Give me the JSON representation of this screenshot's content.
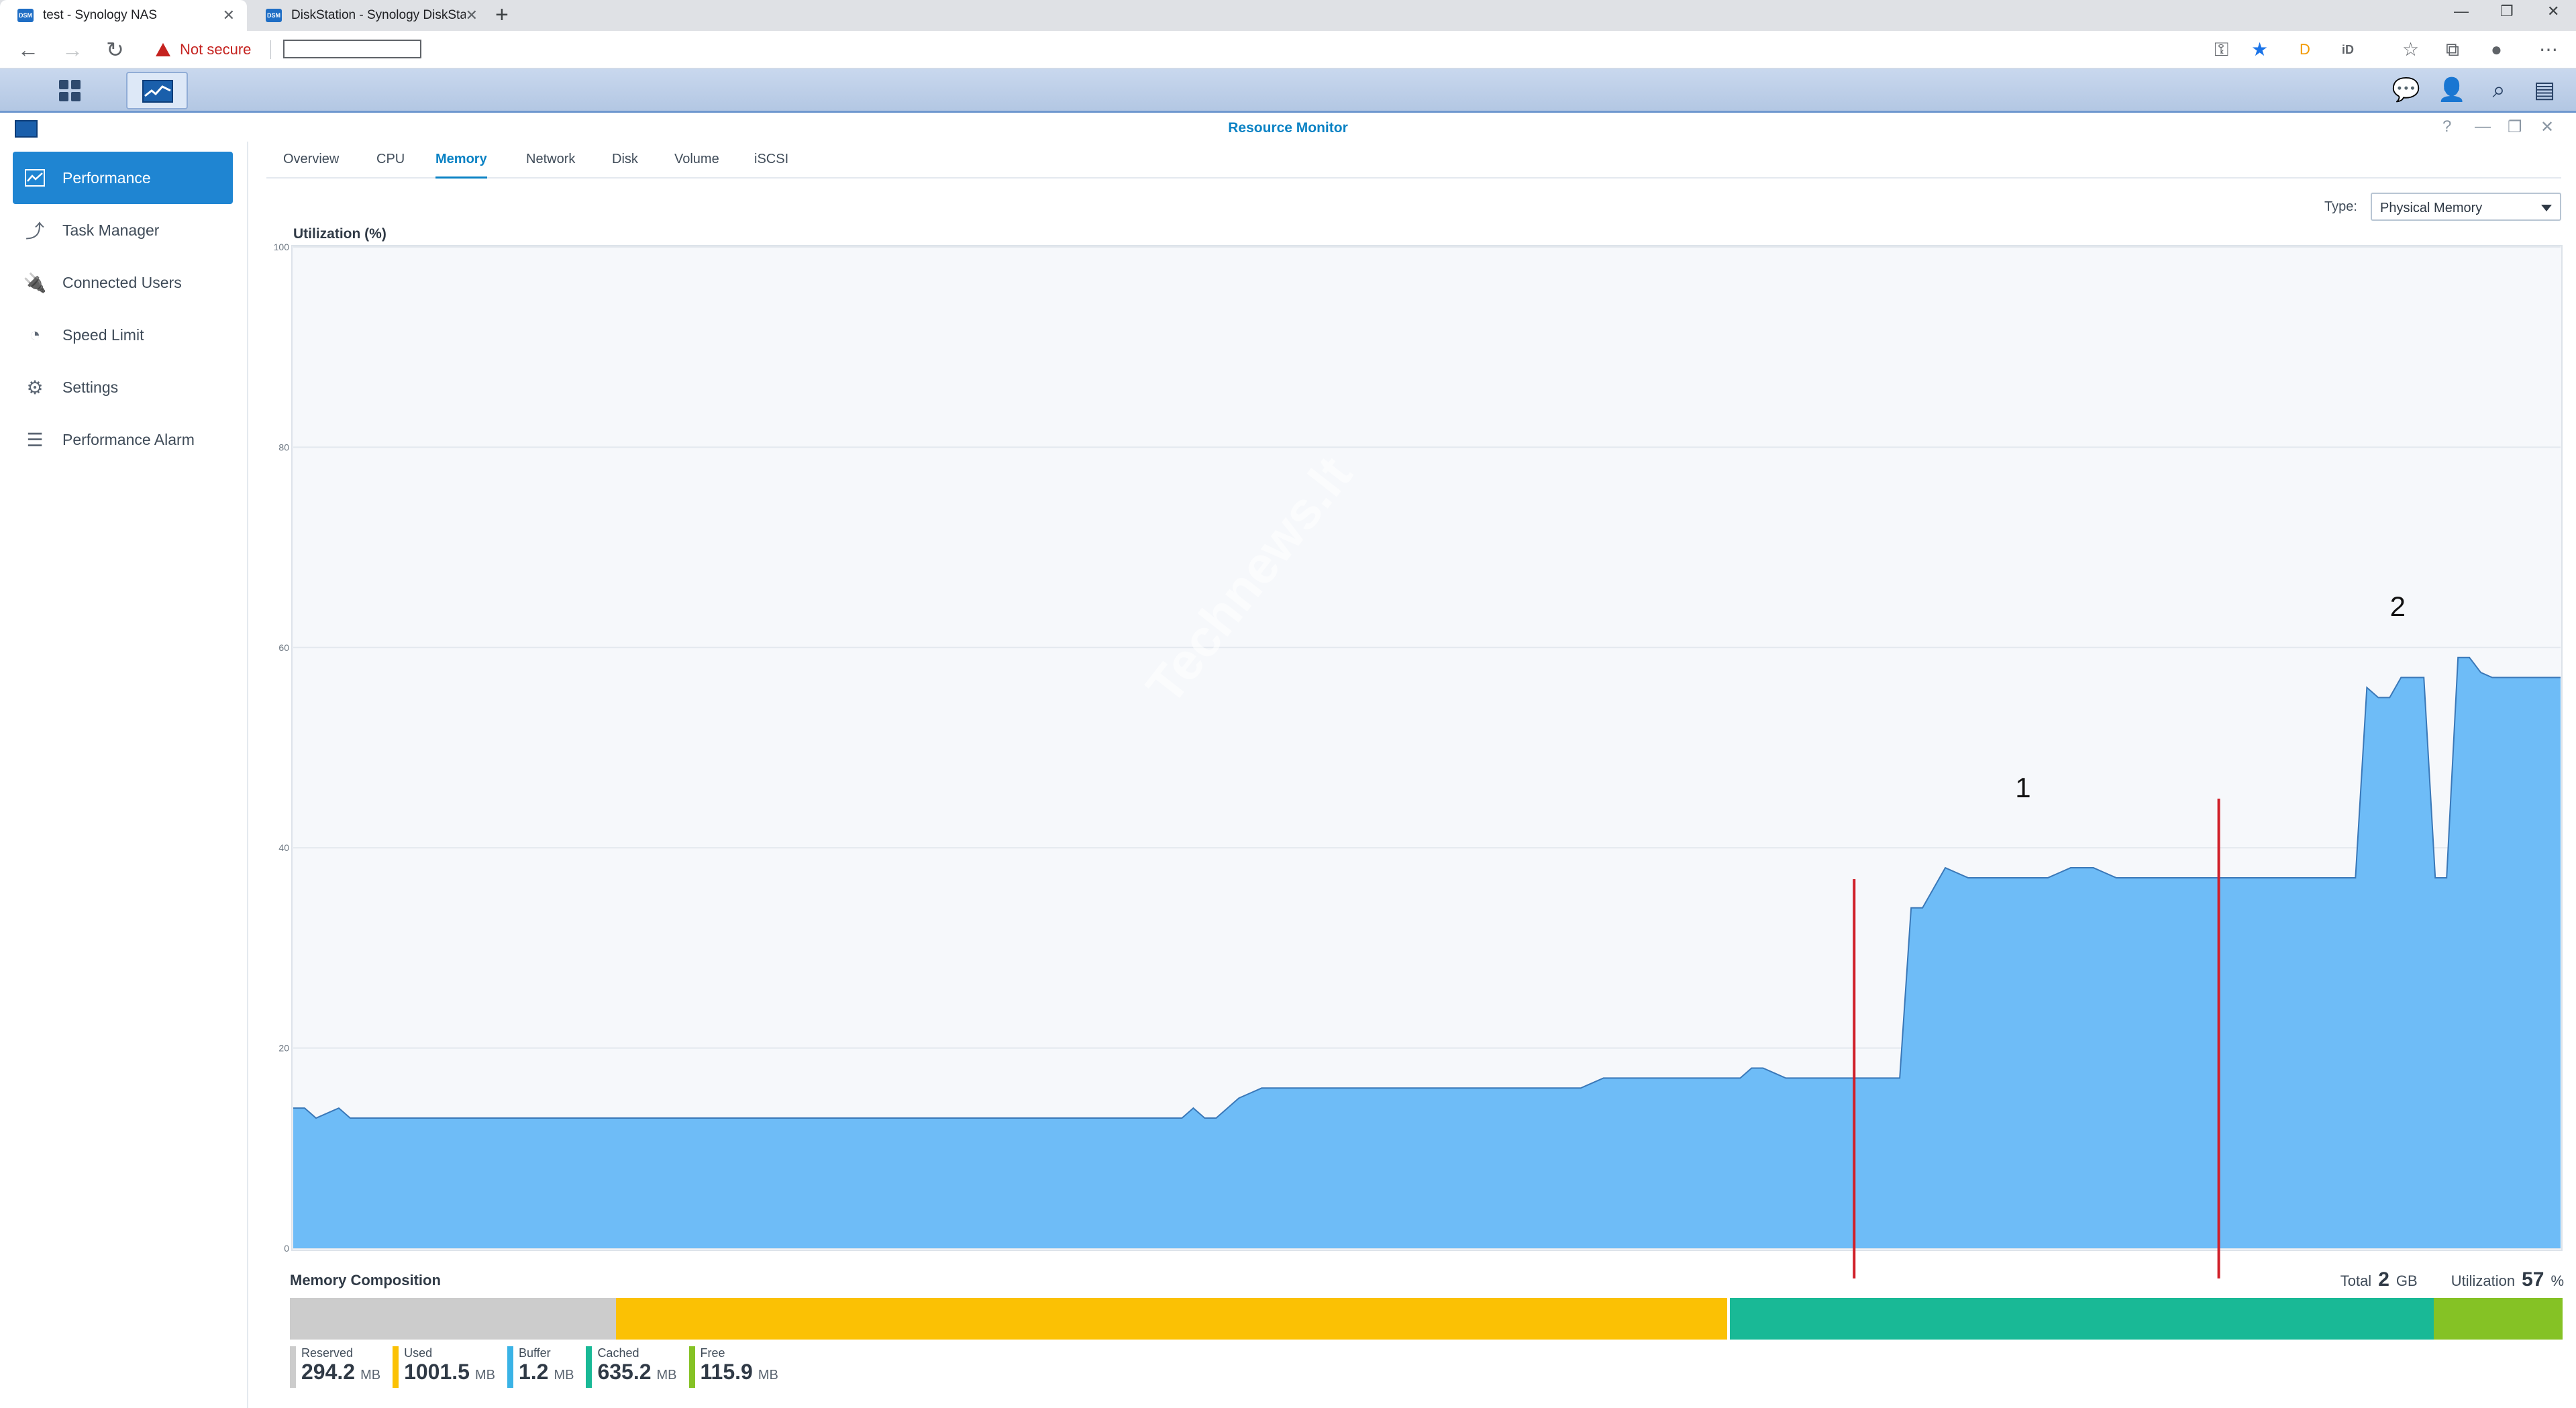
{
  "browser": {
    "tabs": [
      {
        "title": "test - Synology NAS",
        "favicon": "DSM",
        "active": true
      },
      {
        "title": "DiskStation - Synology DiskStati",
        "favicon": "DSM",
        "active": false
      }
    ],
    "not_secure": "Not secure",
    "url": ""
  },
  "window": {
    "title": "Resource Monitor"
  },
  "sidebar": {
    "items": [
      {
        "label": "Performance",
        "icon": "performance-icon",
        "active": true
      },
      {
        "label": "Task Manager",
        "icon": "task-manager-icon",
        "active": false
      },
      {
        "label": "Connected Users",
        "icon": "plug-icon",
        "active": false
      },
      {
        "label": "Speed Limit",
        "icon": "gauge-icon",
        "active": false
      },
      {
        "label": "Settings",
        "icon": "gear-icon",
        "active": false
      },
      {
        "label": "Performance Alarm",
        "icon": "list-icon",
        "active": false
      }
    ]
  },
  "tabs": [
    {
      "label": "Overview",
      "active": false
    },
    {
      "label": "CPU",
      "active": false
    },
    {
      "label": "Memory",
      "active": true
    },
    {
      "label": "Network",
      "active": false
    },
    {
      "label": "Disk",
      "active": false
    },
    {
      "label": "Volume",
      "active": false
    },
    {
      "label": "iSCSI",
      "active": false
    }
  ],
  "type_select": {
    "label": "Type:",
    "value": "Physical Memory"
  },
  "chart_data": {
    "type": "area",
    "ylabel": "Utilization (%)",
    "ylim": [
      0,
      100
    ],
    "yticks": [
      0,
      20,
      40,
      60,
      80,
      100
    ],
    "grid": true,
    "color": "#6ebcf7",
    "x": [
      0,
      1,
      2,
      3,
      4,
      5,
      6,
      7,
      8,
      9,
      10,
      11,
      12,
      13,
      14,
      15,
      16,
      17,
      18,
      19,
      20,
      21,
      22,
      23,
      24,
      25,
      26,
      27,
      28,
      29,
      30,
      31,
      32,
      33,
      34,
      35,
      36,
      37,
      38,
      39,
      40,
      41,
      42,
      43,
      44,
      45,
      46,
      47,
      48,
      49,
      50,
      51,
      52,
      53,
      54,
      55,
      56,
      57,
      58,
      59,
      60,
      61,
      62,
      63,
      64,
      65,
      66,
      67,
      68,
      69,
      70,
      71,
      72,
      73,
      74,
      75,
      76,
      77,
      78,
      79,
      80,
      81,
      82,
      83,
      84,
      85,
      86,
      87,
      88,
      89,
      90,
      91,
      92,
      93,
      94,
      95,
      96,
      97,
      98,
      99,
      100,
      101,
      102,
      103,
      104,
      105,
      106,
      107,
      108,
      109,
      110,
      111,
      112,
      113,
      114,
      115,
      116,
      117,
      118,
      119,
      120,
      121,
      122,
      123,
      124,
      125,
      126,
      127,
      128,
      129,
      130,
      131,
      132,
      133,
      134,
      135,
      136,
      137,
      138,
      139,
      140,
      141,
      142,
      143,
      144,
      145,
      146,
      147,
      148,
      149,
      150,
      151,
      152,
      153,
      154,
      155,
      156,
      157,
      158,
      159,
      160,
      161,
      162,
      163,
      164,
      165,
      166,
      167,
      168,
      169,
      170,
      171,
      172,
      173,
      174,
      175,
      176,
      177,
      178,
      179,
      180,
      181,
      182,
      183,
      184,
      185,
      186,
      187,
      188,
      189,
      190,
      191,
      192,
      193,
      194,
      195,
      196,
      197,
      198,
      199
    ],
    "values": [
      14,
      14,
      13,
      13.5,
      14,
      13,
      13,
      13,
      13,
      13,
      13,
      13,
      13,
      13,
      13,
      13,
      13,
      13,
      13,
      13,
      13,
      13,
      13,
      13,
      13,
      13,
      13,
      13,
      13,
      13,
      13,
      13,
      13,
      13,
      13,
      13,
      13,
      13,
      13,
      13,
      13,
      13,
      13,
      13,
      13,
      13,
      13,
      13,
      13,
      13,
      13,
      13,
      13,
      13,
      13,
      13,
      13,
      13,
      13,
      13,
      13,
      13,
      13,
      13,
      13,
      13,
      13,
      13,
      13,
      13,
      13,
      13,
      13,
      13,
      13,
      13,
      13,
      13,
      13,
      14,
      13,
      13,
      14,
      15,
      15.5,
      16,
      16,
      16,
      16,
      16,
      16,
      16,
      16,
      16,
      16,
      16,
      16,
      16,
      16,
      16,
      16,
      16,
      16,
      16,
      16,
      16,
      16,
      16,
      16,
      16,
      16,
      16,
      16,
      16,
      16.5,
      17,
      17,
      17,
      17,
      17,
      17,
      17,
      17,
      17,
      17,
      17,
      17,
      17,
      18,
      18,
      17.5,
      17,
      17,
      17,
      17,
      17,
      17,
      17,
      17,
      17,
      17,
      17,
      34,
      34,
      36,
      38,
      37.5,
      37,
      37,
      37,
      37,
      37,
      37,
      37,
      37,
      37.5,
      38,
      38,
      38,
      37.5,
      37,
      37,
      37,
      37,
      37,
      37,
      37,
      37,
      37,
      37,
      37,
      37,
      37,
      37,
      37,
      37,
      37,
      37,
      37,
      37,
      37,
      37,
      56,
      55,
      55,
      57,
      57,
      57,
      37,
      37,
      59,
      59,
      57.5,
      57,
      57,
      57,
      57,
      57,
      57,
      57,
      57,
      57,
      57,
      57,
      57,
      57,
      57,
      57,
      57,
      57,
      57,
      57,
      57
    ],
    "markers": [
      {
        "label": "1",
        "x": 137
      },
      {
        "label": "2",
        "x": 169
      }
    ]
  },
  "memory_composition": {
    "title": "Memory Composition",
    "total_label": "Total",
    "total_value": "2",
    "total_unit": "GB",
    "util_label": "Utilization",
    "util_value": "57",
    "util_unit": "%",
    "segments": [
      {
        "name": "Reserved",
        "value": "294.2",
        "unit": "MB",
        "mb": 294.2,
        "color": "#cccccc"
      },
      {
        "name": "Used",
        "value": "1001.5",
        "unit": "MB",
        "mb": 1001.5,
        "color": "#fbc104"
      },
      {
        "name": "Buffer",
        "value": "1.2",
        "unit": "MB",
        "mb": 1.2,
        "color": "#3ab3e6"
      },
      {
        "name": "Cached",
        "value": "635.2",
        "unit": "MB",
        "mb": 635.2,
        "color": "#19b996"
      },
      {
        "name": "Free",
        "value": "115.9",
        "unit": "MB",
        "mb": 115.9,
        "color": "#85c225"
      }
    ]
  }
}
